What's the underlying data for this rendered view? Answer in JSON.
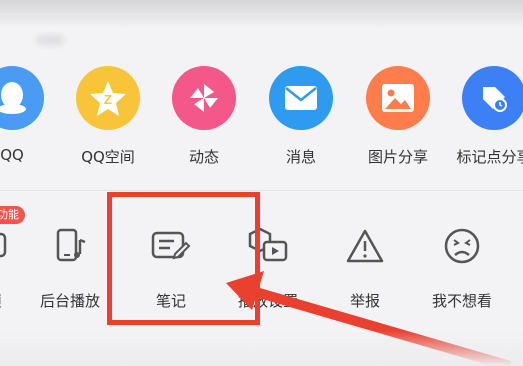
{
  "share_targets": [
    {
      "label": "QQ",
      "icon": "qq-penguin-icon",
      "color": "#4a9bf3"
    },
    {
      "label": "QQ空间",
      "icon": "qzone-star-icon",
      "color": "#f7c43a"
    },
    {
      "label": "动态",
      "icon": "pinwheel-icon",
      "color": "#f4578a"
    },
    {
      "label": "消息",
      "icon": "envelope-icon",
      "color": "#2f9bf0"
    },
    {
      "label": "图片分享",
      "icon": "picture-icon",
      "color": "#ff7d4d"
    },
    {
      "label": "标记点分享",
      "icon": "pin-marker-icon",
      "color": "#3d80f5"
    }
  ],
  "actions": [
    {
      "label": "频",
      "icon": "video-icon"
    },
    {
      "label": "后台播放",
      "icon": "phone-music-icon"
    },
    {
      "label": "笔记",
      "icon": "note-pencil-icon"
    },
    {
      "label": "播放设置",
      "icon": "play-settings-icon"
    },
    {
      "label": "举报",
      "icon": "warning-icon"
    },
    {
      "label": "我不想看",
      "icon": "sad-face-icon"
    }
  ],
  "badge_text": "功能",
  "colors": {
    "highlight": "#e9402f",
    "text": "#333333",
    "icon_stroke": "#555555"
  }
}
